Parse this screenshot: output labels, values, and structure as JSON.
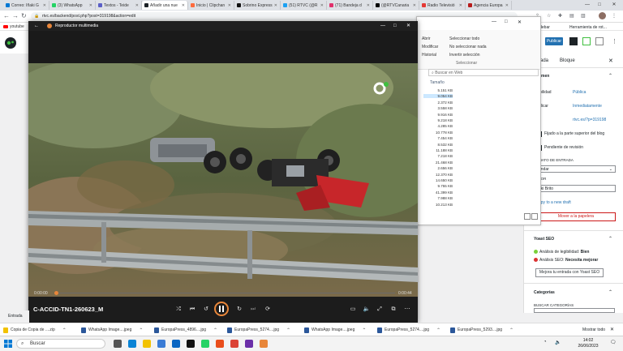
{
  "browser": {
    "tabs": [
      {
        "label": "Correo: Iñaki G",
        "color": "#0078d4"
      },
      {
        "label": "(3) WhatsApp",
        "color": "#25d366"
      },
      {
        "label": "Textos - Teide",
        "color": "#5b5fc7"
      },
      {
        "label": "Añadir una nue",
        "color": "#1d2327"
      },
      {
        "label": "Inicio | Clipchan",
        "color": "#ff6b3d"
      },
      {
        "label": "Sobrino Express",
        "color": "#111"
      },
      {
        "label": "(51) RTVC (@R",
        "color": "#1da1f2"
      },
      {
        "label": "(71) Bandeja d",
        "color": "#e1306c"
      },
      {
        "label": "(@RTVCanaria",
        "color": "#000"
      },
      {
        "label": "Radio Televisió",
        "color": "#e53935"
      },
      {
        "label": "Agencia Europa",
        "color": "#b71c1c"
      }
    ],
    "url": "rtvc.es/backend/post.php?post=319198&action=edit",
    "bookmark": "youtube",
    "win_minimize": "—",
    "win_maximize": "□",
    "win_close": "✕"
  },
  "wp_sidebar": {
    "top_links": [
      "idebar",
      "Herramienta de rot..."
    ],
    "publish": "Publicar",
    "tabs": {
      "entrada": "rada",
      "bloque": "Bloque"
    },
    "section_resumen": "umen",
    "visibility_label": "ibilidad",
    "visibility_value": "Pública",
    "publish_label": "blicar",
    "publish_value": "Inmediatamente",
    "url_value": "rtvc.es/?p=319198",
    "sticky_label": "Fijado a la parte superior del blog",
    "pending_label": "Pendiente de revisión",
    "format_label": "MATO DE ENTRADA",
    "format_value": "andar",
    "author_label": "TOR",
    "author_value": "aki Brito",
    "copy_draft": "opy to a new draft",
    "trash": "Mover a la papelera",
    "yoast_title": "Yoast SEO",
    "readability": "Análisis de legibilidad:",
    "readability_value": "Bien",
    "seo": "Análisis SEO:",
    "seo_value": "Necesita mejorar",
    "improve_btn": "Mejora tu entrada con Yoast SEO",
    "categories": "Categorías",
    "search_categories": "BUSCAR CATEGORÍAS",
    "status_colors": {
      "good": "#7ad03a",
      "bad": "#dc3232"
    }
  },
  "explorer": {
    "ribbon": {
      "share": "Abrir",
      "modify": "Modificar",
      "history": "Historial",
      "select_all": "Seleccionar todo",
      "select_none": "No seleccionar nada",
      "invert": "Invertir selección",
      "group": "Seleccionar"
    },
    "search_placeholder": "Buscar en Web",
    "column": "Tamaño",
    "sizes": [
      "5.151 KB",
      "9.054 KB",
      "2.372 KB",
      "3.558 KB",
      "9.916 KB",
      "9.218 KB",
      "4.285 KB",
      "10.778 KB",
      "7.454 KB",
      "8.532 KB",
      "11.188 KB",
      "7.218 KB",
      "21.468 KB",
      "2.656 KB",
      "12.370 KB",
      "14.650 KB",
      "9.755 KB",
      "41.399 KB",
      "7.988 KB",
      "10.213 KB"
    ],
    "win_minimize": "—",
    "win_maximize": "□",
    "win_close": "✕"
  },
  "player": {
    "title": "Reproductor multimedia",
    "time_current": "0:00:00",
    "time_total": "0:00:44",
    "file_name": "C-ACCID-TN1-260623_M",
    "progress": 0.0,
    "accent": "#e8863a",
    "win_minimize": "—",
    "win_maximize": "□",
    "win_close": "✕"
  },
  "status_label": "Entrada",
  "downloads": {
    "items": [
      "Copia de Copia de ....zip",
      "WhatsApp Image....jpeg",
      "EuropaPress_4896....jpg",
      "EuropaPress_5274....jpg",
      "WhatsApp Image....jpeg",
      "EuropaPress_5274....jpg",
      "EuropaPress_5293....jpg"
    ],
    "show_all": "Mostrar todo"
  },
  "taskbar": {
    "search": "Buscar",
    "time": "14:02",
    "date": "26/06/2023"
  }
}
